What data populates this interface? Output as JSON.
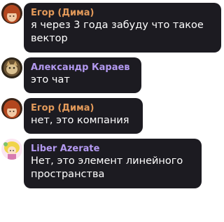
{
  "messages": [
    {
      "author": "Егор (Дима)",
      "author_color": "#e39a5a",
      "text_lines": [
        "я через 3 года забуду что такое",
        "вектор"
      ],
      "avatar": "avatar-red-hair-icon"
    },
    {
      "author": "Александр Караев",
      "author_color": "#b399f0",
      "text_lines": [
        "это чат"
      ],
      "avatar": "avatar-cat-icon"
    },
    {
      "author": "Егор (Дима)",
      "author_color": "#e39a5a",
      "text_lines": [
        "нет, это компания"
      ],
      "avatar": "avatar-red-hair-icon"
    },
    {
      "author": "Liber Azerate",
      "author_color": "#b399f0",
      "text_lines": [
        "Нет, это элемент линейного",
        "пространства"
      ],
      "avatar": "avatar-anime-icon"
    }
  ],
  "colors": {
    "bubble": "#1c1b21",
    "background": "#ffffff",
    "text": "#ffffff"
  }
}
